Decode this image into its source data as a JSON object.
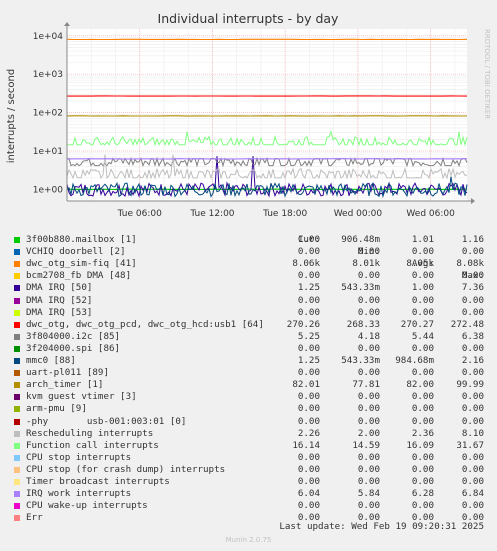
{
  "chart_data": {
    "type": "line",
    "title": "Individual interrupts - by day",
    "ylabel": "interrupts / second",
    "side_label": "RRDTOOL / TOBI OETIKER",
    "y_scale": "log",
    "ylim": [
      0.5,
      15000
    ],
    "y_ticks": [
      {
        "value": 1,
        "label": "1e+00"
      },
      {
        "value": 10,
        "label": "1e+01"
      },
      {
        "value": 100,
        "label": "1e+02"
      },
      {
        "value": 1000,
        "label": "1e+03"
      },
      {
        "value": 10000,
        "label": "1e+04"
      }
    ],
    "x_range_hours": [
      0,
      33
    ],
    "x_ticks": [
      {
        "hour": 6,
        "label": "Tue 06:00"
      },
      {
        "hour": 12,
        "label": "Tue 12:00"
      },
      {
        "hour": 18,
        "label": "Tue 18:00"
      },
      {
        "hour": 24,
        "label": "Wed 00:00"
      },
      {
        "hour": 30,
        "label": "Wed 06:00"
      }
    ],
    "grid": true,
    "legend_columns": [
      "Cur:",
      "Min:",
      "Avg:",
      "Max:"
    ],
    "series": [
      {
        "name": "3f00b880.mailbox [1]",
        "color": "#00cc00",
        "cur": "1.00",
        "min": "906.48m",
        "avg": "1.01",
        "max": "1.16"
      },
      {
        "name": "VCHIQ doorbell [2]",
        "color": "#0066b3",
        "cur": "0.00",
        "min": "0.00",
        "avg": "0.00",
        "max": "0.00"
      },
      {
        "name": "dwc_otg_sim-fiq [41]",
        "color": "#ff8000",
        "cur": "8.06k",
        "min": "8.01k",
        "avg": "8.05k",
        "max": "8.08k"
      },
      {
        "name": "bcm2708_fb DMA [48]",
        "color": "#ffcc00",
        "cur": "0.00",
        "min": "0.00",
        "avg": "0.00",
        "max": "0.00"
      },
      {
        "name": "DMA IRQ [50]",
        "color": "#330099",
        "cur": "1.25",
        "min": "543.33m",
        "avg": "1.00",
        "max": "7.36"
      },
      {
        "name": "DMA IRQ [52]",
        "color": "#990099",
        "cur": "0.00",
        "min": "0.00",
        "avg": "0.00",
        "max": "0.00"
      },
      {
        "name": "DMA IRQ [53]",
        "color": "#ccff00",
        "cur": "0.00",
        "min": "0.00",
        "avg": "0.00",
        "max": "0.00"
      },
      {
        "name": "dwc_otg, dwc_otg_pcd, dwc_otg_hcd:usb1 [64]",
        "color": "#ff0000",
        "cur": "270.26",
        "min": "268.33",
        "avg": "270.27",
        "max": "272.48"
      },
      {
        "name": "3f804000.i2c [85]",
        "color": "#808080",
        "cur": "5.25",
        "min": "4.18",
        "avg": "5.44",
        "max": "6.38"
      },
      {
        "name": "3f204000.spi [86]",
        "color": "#008f00",
        "cur": "0.00",
        "min": "0.00",
        "avg": "0.00",
        "max": "0.00"
      },
      {
        "name": "mmc0 [88]",
        "color": "#00487d",
        "cur": "1.25",
        "min": "543.33m",
        "avg": "984.68m",
        "max": "2.16"
      },
      {
        "name": "uart-pl011 [89]",
        "color": "#b35a00",
        "cur": "0.00",
        "min": "0.00",
        "avg": "0.00",
        "max": "0.00"
      },
      {
        "name": "arch_timer [1]",
        "color": "#b38f00",
        "cur": "82.01",
        "min": "77.81",
        "avg": "82.00",
        "max": "99.99"
      },
      {
        "name": "kvm guest vtimer [3]",
        "color": "#6b006b",
        "cur": "0.00",
        "min": "0.00",
        "avg": "0.00",
        "max": "0.00"
      },
      {
        "name": "arm-pmu [9]",
        "color": "#8fb300",
        "cur": "0.00",
        "min": "0.00",
        "avg": "0.00",
        "max": "0.00"
      },
      {
        "name": "-phy       usb-001:003:01 [0]",
        "color": "#b30000",
        "cur": "0.00",
        "min": "0.00",
        "avg": "0.00",
        "max": "0.00"
      },
      {
        "name": "Rescheduling interrupts",
        "color": "#bebebe",
        "cur": "2.26",
        "min": "2.00",
        "avg": "2.36",
        "max": "8.10"
      },
      {
        "name": "Function call interrupts",
        "color": "#80ff80",
        "cur": "16.14",
        "min": "14.59",
        "avg": "16.09",
        "max": "31.67"
      },
      {
        "name": "CPU stop interrupts",
        "color": "#80c9ff",
        "cur": "0.00",
        "min": "0.00",
        "avg": "0.00",
        "max": "0.00"
      },
      {
        "name": "CPU stop (for crash dump) interrupts",
        "color": "#ffc080",
        "cur": "0.00",
        "min": "0.00",
        "avg": "0.00",
        "max": "0.00"
      },
      {
        "name": "Timer broadcast interrupts",
        "color": "#ffe680",
        "cur": "0.00",
        "min": "0.00",
        "avg": "0.00",
        "max": "0.00"
      },
      {
        "name": "IRQ work interrupts",
        "color": "#aa80ff",
        "cur": "6.04",
        "min": "5.84",
        "avg": "6.28",
        "max": "6.84"
      },
      {
        "name": "CPU wake-up interrupts",
        "color": "#ee00cc",
        "cur": "0.00",
        "min": "0.00",
        "avg": "0.00",
        "max": "0.00"
      },
      {
        "name": "Err",
        "color": "#ff8080",
        "cur": "0.00",
        "min": "0.00",
        "avg": "0.00",
        "max": "0.00"
      }
    ]
  },
  "footer": {
    "last_update": "Last update: Wed Feb 19 09:20:31 2025",
    "generator": "Munin 2.0.75"
  }
}
